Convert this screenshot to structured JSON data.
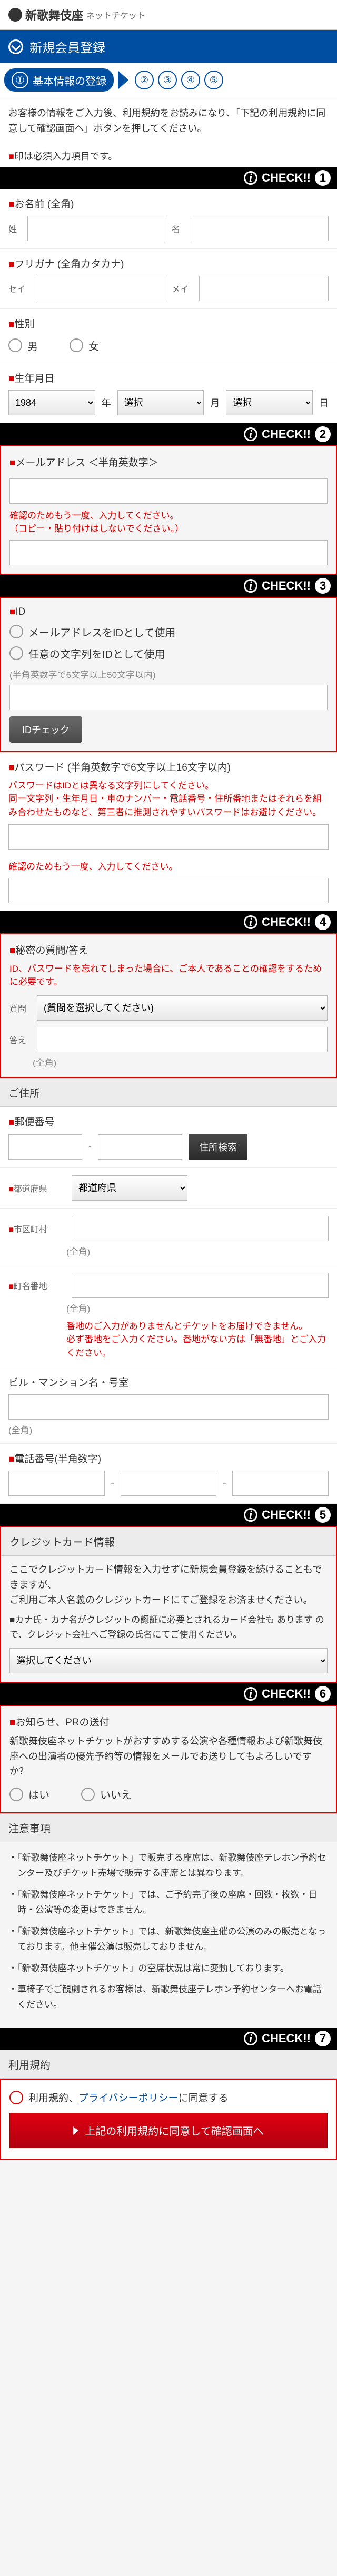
{
  "header": {
    "brand_main": "新歌舞伎座",
    "brand_sub": "ネットチケット"
  },
  "title": "新規会員登録",
  "steps": {
    "active_num": "①",
    "active_label": "基本情報の登録",
    "others": [
      "②",
      "③",
      "④",
      "⑤"
    ]
  },
  "intro": "お客様の情報をご入力後、利用規約をお読みになり、「下記の利用規約に同意して確認画面へ」ボタンを押してください。",
  "req_note_prefix": "■",
  "req_note": "印は必須入力項目です。",
  "checks": {
    "c1": "CHECK!!",
    "c2": "CHECK!!",
    "c3": "CHECK!!",
    "c4": "CHECK!!",
    "c5": "CHECK!!",
    "c6": "CHECK!!",
    "c7": "CHECK!!"
  },
  "name": {
    "label": "お名前 (全角)",
    "sei": "姓",
    "mei": "名"
  },
  "kana": {
    "label": "フリガナ (全角カタカナ)",
    "sei": "セイ",
    "mei": "メイ"
  },
  "gender": {
    "label": "性別",
    "m": "男",
    "f": "女"
  },
  "birth": {
    "label": "生年月日",
    "year": "1984",
    "y": "年",
    "month": "選択",
    "m": "月",
    "day": "選択",
    "d": "日"
  },
  "email": {
    "label": "メールアドレス ＜半角英数字＞",
    "warn": "確認のためもう一度、入力してください。\n（コピー・貼り付けはしないでください。）"
  },
  "id": {
    "label": "ID",
    "opt1": "メールアドレスをIDとして使用",
    "opt2": "任意の文字列をIDとして使用",
    "hint": "(半角英数字で6文字以上50文字以内)",
    "btn": "IDチェック"
  },
  "password": {
    "label": "パスワード (半角英数字で6文字以上16文字以内)",
    "warn1": "パスワードはIDとは異なる文字列にしてください。\n同一文字列・生年月日・車のナンバー・電話番号・住所番地またはそれらを組み合わせたものなど、第三者に推測されやすいパスワードはお避けください。",
    "warn2": "確認のためもう一度、入力してください。"
  },
  "secret": {
    "label": "秘密の質問/答え",
    "warn": "ID、パスワードを忘れてしまった場合に、ご本人であることの確認をするために必要です。",
    "q": "質問",
    "q_placeholder": "(質問を選択してください)",
    "a": "答え",
    "a_hint": "(全角)"
  },
  "addr": {
    "head": "ご住所",
    "zip_label": "郵便番号",
    "search": "住所検索",
    "pref_label": "都道府県",
    "pref_placeholder": "都道府県",
    "city_label": "市区町村",
    "city_hint": "(全角)",
    "town_label": "町名番地",
    "town_hint": "(全角)",
    "town_warn": "番地のご入力がありませんとチケットをお届けできません。\n必ず番地をご入力ください。番地がない方は「無番地」とご入力ください。",
    "bldg_label": "ビル・マンション名・号室",
    "bldg_hint": "(全角)"
  },
  "tel": {
    "label": "電話番号(半角数字)"
  },
  "cc": {
    "head": "クレジットカード情報",
    "text": "ここでクレジットカード情報を入力せずに新規会員登録を続けることもできますが、\nご利用ご本人名義のクレジットカードにてご登録をお済ませください。",
    "note": "■カナ氏・カナ名がクレジットの認証に必要とされるカード会社も あります ので、クレジット会社へご登録の氏名にてご使用ください。",
    "placeholder": "選択してください"
  },
  "pr": {
    "label": "お知らせ、PRの送付",
    "text": "新歌舞伎座ネットチケットがおすすめする公演や各種情報および新歌舞伎座への出演者の優先予約等の情報をメールでお送りしてもよろしいですか？",
    "yes": "はい",
    "no": "いいえ"
  },
  "notices": {
    "head": "注意事項",
    "items": [
      "「新歌舞伎座ネットチケット」で販売する座席は、新歌舞伎座テレホン予約センター及びチケット売場で販売する座席とは異なります。",
      "「新歌舞伎座ネットチケット」では、ご予約完了後の座席・回数・枚数・日時・公演等の変更はできません。",
      "「新歌舞伎座ネットチケット」では、新歌舞伎座主催の公演のみの販売となっております。他主催公演は販売しておりません。",
      "「新歌舞伎座ネットチケット」の空席状況は常に変動しております。",
      "車椅子でご観劇されるお客様は、新歌舞伎座テレホン予約センターへお電話ください。"
    ]
  },
  "agree": {
    "head": "利用規約",
    "text_pre": "利用規約、",
    "link": "プライバシーポリシー",
    "text_post": "に同意する",
    "submit": "上記の利用規約に同意して確認画面へ"
  }
}
